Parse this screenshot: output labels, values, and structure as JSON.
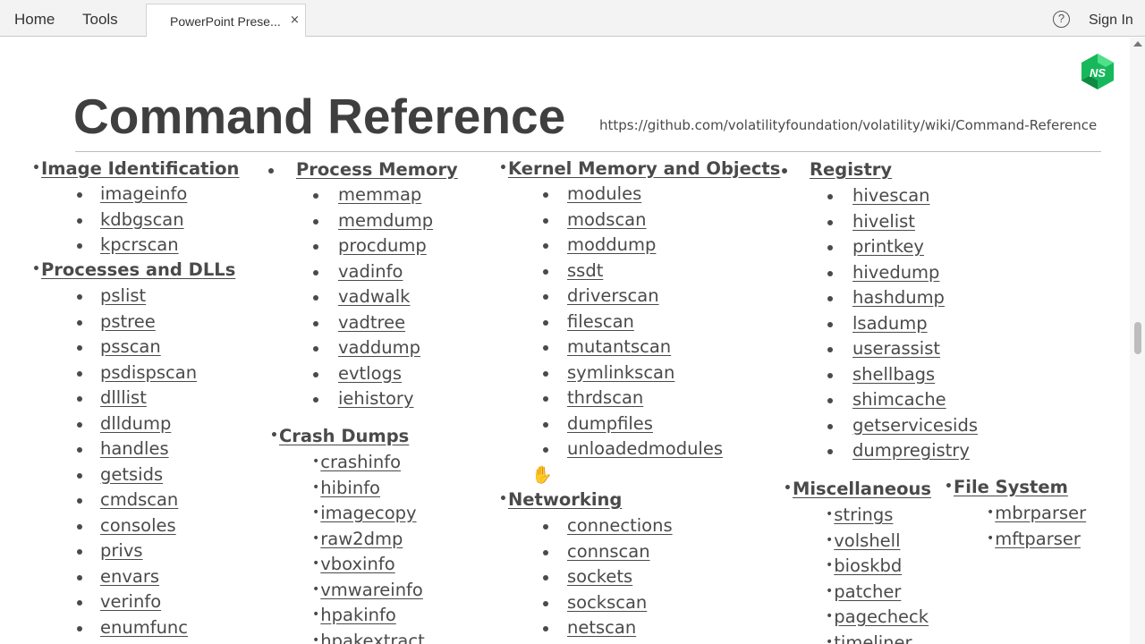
{
  "topbar": {
    "menu": [
      "Home",
      "Tools"
    ],
    "tab_title": "PowerPoint Prese...",
    "tab_close": "×",
    "help": "?",
    "sign_in": "Sign In"
  },
  "slide": {
    "logo_text": "NS",
    "title": "Command Reference",
    "url": "https://github.com/volatilityfoundation/volatility/wiki/Command-Reference"
  },
  "groups": [
    {
      "heading": "Image Identification",
      "items": [
        "imageinfo",
        "kdbgscan",
        "kpcrscan"
      ]
    },
    {
      "heading": "Processes and DLLs",
      "items": [
        "pslist",
        "pstree",
        "psscan",
        "psdispscan",
        "dlllist",
        "dlldump",
        "handles",
        "getsids",
        "cmdscan",
        "consoles",
        "privs",
        "envars",
        "verinfo",
        "enumfunc"
      ]
    },
    {
      "heading": "Process Memory",
      "items": [
        "memmap",
        "memdump",
        "procdump",
        "vadinfo",
        "vadwalk",
        "vadtree",
        "vaddump",
        "evtlogs",
        "iehistory"
      ]
    },
    {
      "heading": "Crash Dumps",
      "items": [
        "crashinfo",
        "hibinfo",
        "imagecopy",
        "raw2dmp",
        "vboxinfo",
        "vmwareinfo",
        "hpakinfo",
        "hpakextract"
      ]
    },
    {
      "heading": "Kernel Memory and Objects",
      "items": [
        "modules",
        "modscan",
        "moddump",
        "ssdt",
        "driverscan",
        "filescan",
        "mutantscan",
        "symlinkscan",
        "thrdscan",
        "dumpfiles",
        "unloadedmodules"
      ]
    },
    {
      "heading": "Networking",
      "items": [
        "connections",
        "connscan",
        "sockets",
        "sockscan",
        "netscan"
      ]
    },
    {
      "heading": "Registry",
      "items": [
        "hivescan",
        "hivelist",
        "printkey",
        "hivedump",
        "hashdump",
        "lsadump",
        "userassist",
        "shellbags",
        "shimcache",
        "getservicesids",
        "dumpregistry"
      ]
    },
    {
      "heading": "Miscellaneous",
      "items": [
        "strings",
        "volshell",
        "bioskbd",
        "patcher",
        "pagecheck",
        "timeliner"
      ]
    },
    {
      "heading": "File System",
      "items": [
        "mbrparser",
        "mftparser"
      ]
    }
  ]
}
